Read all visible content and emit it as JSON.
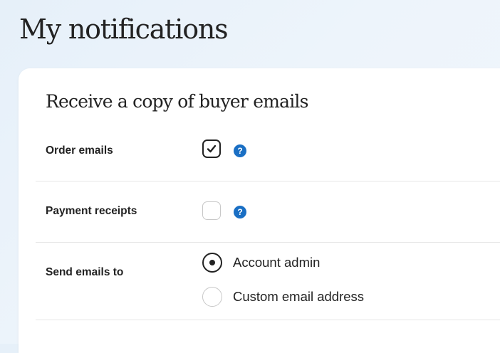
{
  "page": {
    "title": "My notifications"
  },
  "section": {
    "title": "Receive a copy of buyer emails"
  },
  "rows": {
    "order_emails": {
      "label": "Order emails",
      "checked": true,
      "help_icon": "question-circle"
    },
    "payment_receipts": {
      "label": "Payment receipts",
      "checked": false,
      "help_icon": "question-circle"
    },
    "send_emails_to": {
      "label": "Send emails to",
      "options": [
        {
          "label": "Account admin",
          "selected": true
        },
        {
          "label": "Custom email address",
          "selected": false
        }
      ]
    }
  },
  "help_symbol": "?",
  "colors": {
    "background": "#eaf2fa",
    "card": "#ffffff",
    "text": "#222222",
    "help_icon": "#1a6fc4",
    "divider": "#e6e6e6",
    "unchecked_border": "#c8c8c8"
  }
}
